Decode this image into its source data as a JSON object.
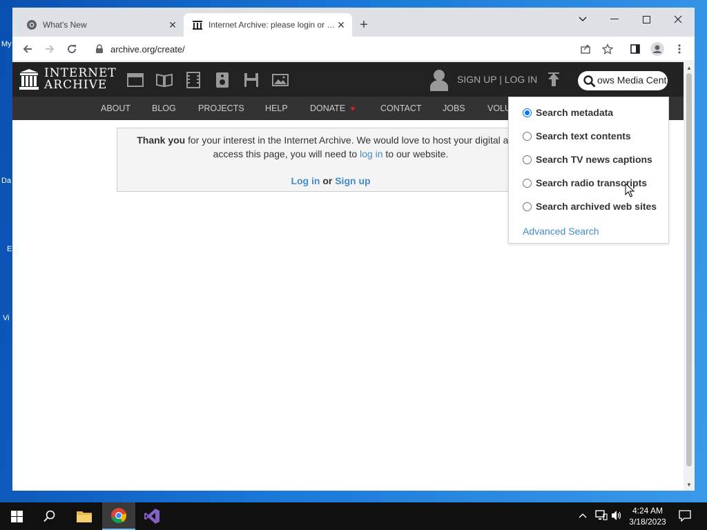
{
  "desktop": {
    "icon_fragments": [
      "My",
      "Da",
      "E",
      "Vi"
    ]
  },
  "browser": {
    "tabs": [
      {
        "title": "What's New",
        "active": false
      },
      {
        "title": "Internet Archive: please login or …",
        "active": true
      }
    ],
    "address": "archive.org/create/"
  },
  "ia": {
    "logo_line1": "INTERNET",
    "logo_line2": "ARCHIVE",
    "auth_links": "SIGN UP | LOG IN",
    "search_value": "ows Media Center",
    "nav": [
      "ABOUT",
      "BLOG",
      "PROJECTS",
      "HELP",
      "DONATE",
      "CONTACT",
      "JOBS",
      "VOLU"
    ],
    "message": {
      "thank_you": "Thank you",
      "line1_rest": " for your interest in the Internet Archive. We would love to host your digital artifa",
      "line2_prefix": "access this page, you will need to ",
      "line2_link": "log in",
      "line2_suffix": " to our website.",
      "login_link": "Log in",
      "or": " or ",
      "signup_link": "Sign up"
    },
    "search_options": [
      {
        "label": "Search metadata",
        "checked": true
      },
      {
        "label": "Search text contents",
        "checked": false
      },
      {
        "label": "Search TV news captions",
        "checked": false
      },
      {
        "label": "Search radio transcripts",
        "checked": false
      },
      {
        "label": "Search archived web sites",
        "checked": false
      }
    ],
    "advanced_search": "Advanced Search"
  },
  "taskbar": {
    "time": "4:24 AM",
    "date": "3/18/2023"
  },
  "colors": {
    "ia_dark": "#222222",
    "ia_nav": "#333333",
    "link_blue": "#428bca",
    "donate_heart": "#e02020"
  }
}
